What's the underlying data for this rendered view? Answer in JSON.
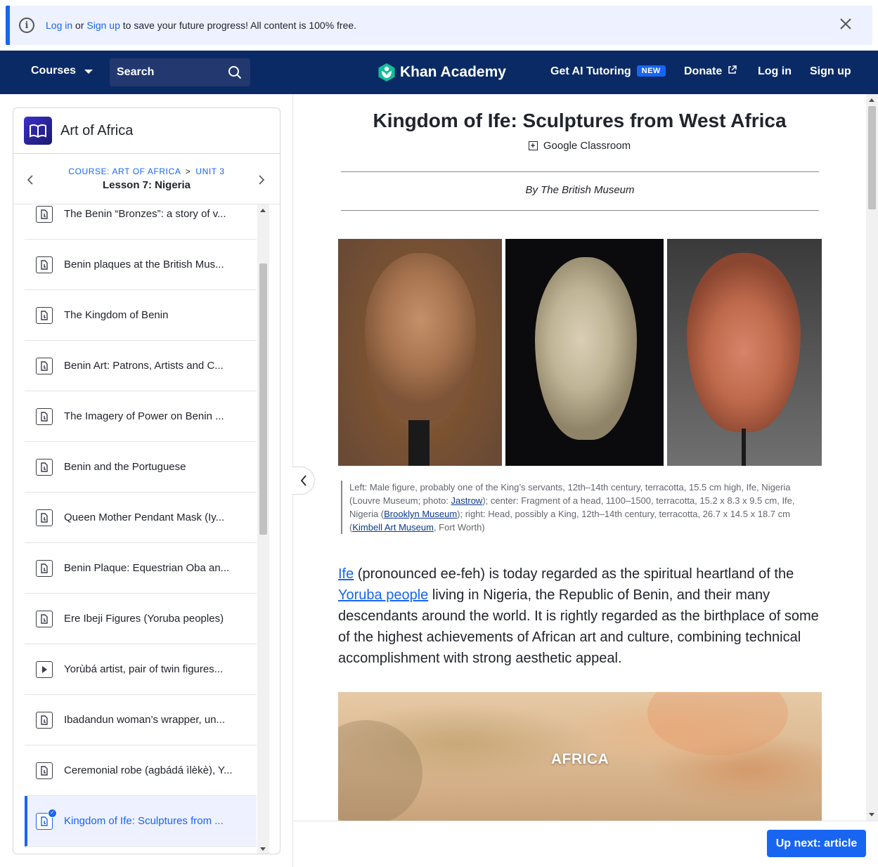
{
  "banner": {
    "login_link": "Log in",
    "or_text": " or ",
    "signup_link": "Sign up",
    "rest_text": " to save your future progress! All content is 100% free."
  },
  "nav": {
    "courses": "Courses",
    "search_placeholder": "Search",
    "logo_text": "Khan Academy",
    "ai_tutoring": "Get AI Tutoring",
    "new_badge": "NEW",
    "donate": "Donate",
    "login": "Log in",
    "signup": "Sign up"
  },
  "sidebar": {
    "course_title": "Art of Africa",
    "breadcrumb_course": "COURSE: ART OF AFRICA",
    "breadcrumb_sep": ">",
    "breadcrumb_unit": "UNIT 3",
    "lesson": "Lesson 7: Nigeria",
    "items": [
      {
        "label": "The Benin “Bronzes”: a story of v...",
        "type": "article"
      },
      {
        "label": "Benin plaques at the British Mus...",
        "type": "article"
      },
      {
        "label": "The Kingdom of Benin",
        "type": "article"
      },
      {
        "label": "Benin Art: Patrons, Artists and C...",
        "type": "article"
      },
      {
        "label": "The Imagery of Power on Benin ...",
        "type": "article"
      },
      {
        "label": "Benin and the Portuguese",
        "type": "article"
      },
      {
        "label": "Queen Mother Pendant Mask (Iy...",
        "type": "article"
      },
      {
        "label": "Benin Plaque: Equestrian Oba an...",
        "type": "article"
      },
      {
        "label": "Ere Ibeji Figures (Yoruba peoples)",
        "type": "article"
      },
      {
        "label": "Yorùbá artist, pair of twin figures...",
        "type": "video"
      },
      {
        "label": "Ibadandun woman’s wrapper, un...",
        "type": "article"
      },
      {
        "label": "Ceremonial robe (agbádá ìlèkè), Y...",
        "type": "article"
      },
      {
        "label": "Kingdom of Ife: Sculptures from ...",
        "type": "article",
        "active": true
      }
    ]
  },
  "article": {
    "title": "Kingdom of Ife: Sculptures from West Africa",
    "google_classroom": "Google Classroom",
    "byline": "By The British Museum",
    "caption": {
      "p1": "Left: Male figure, probably one of the King’s servants, 12th–14th century, terracotta, 15.5 cm high, Ife, Nigeria (Louvre Museum; photo: ",
      "link1": "Jastrow",
      "p2": "); center: Fragment of a head, 1100–1500, terracotta, 15.2 x 8.3 x 9.5 cm, Ife, Nigeria (",
      "link2": "Brooklyn Museum",
      "p3": "); right: Head, possibly a King, 12th–14th century, terracotta, 26.7 x 14.5 x 18.7 cm (",
      "link3": "Kimbell Art Museum",
      "p4": ", Fort Worth)"
    },
    "body": {
      "link1": "Ife",
      "t1": " (pronounced ee-feh) is today regarded as the spiritual heartland of the ",
      "link2": "Yoruba people",
      "t2": " living in Nigeria, the Republic of Benin, and their many descendants around the world. It is rightly regarded as the birthplace of some of the highest achievements of African art and culture, combining technical accomplishment with strong aesthetic appeal."
    },
    "map_label": "AFRICA",
    "up_next": "Up next: article"
  },
  "colors": {
    "accent": "#1865f2",
    "navbar": "#0a2a66",
    "banner_bg": "#eef1ff"
  }
}
